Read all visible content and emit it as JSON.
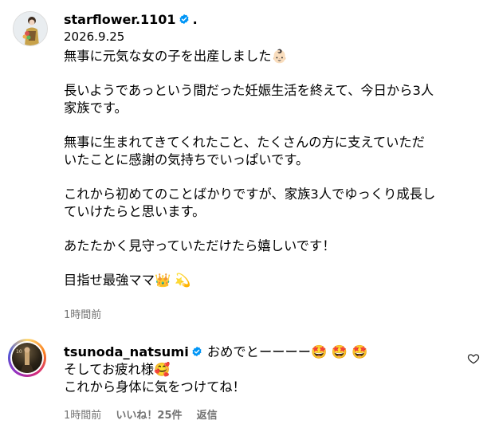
{
  "post": {
    "username": "starflower.1101",
    "separator": ".",
    "date": "2026.9.25",
    "lines": [
      "無事に元気な女の子を出産しました👶🏻",
      "",
      "長いようであっという間だった妊娠生活を終えて、今日から3人",
      "家族です。",
      "",
      "無事に生まれてきてくれたこと、たくさんの方に支えていただ",
      "いたことに感謝の気持ちでいっぱいです。",
      "",
      "これから初めてのことばかりですが、家族3人でゆっくり成長し",
      "ていけたらと思います。",
      "",
      "あたたかく見守っていただけたら嬉しいです！",
      "",
      "目指せ最強ママ👑 💫"
    ],
    "time_ago": "1時間前"
  },
  "comment": {
    "username": "tsunoda_natsumi",
    "text_line1": "おめでとーーーー🤩 🤩 🤩",
    "text_line2": "そしてお疲れ様🥰",
    "text_line3": "これから身体に気をつけてね！",
    "time_ago": "1時間前",
    "likes": "いいね！25件",
    "reply": "返信"
  },
  "colors": {
    "verified": "#0095f6",
    "meta_gray": "#737373"
  }
}
